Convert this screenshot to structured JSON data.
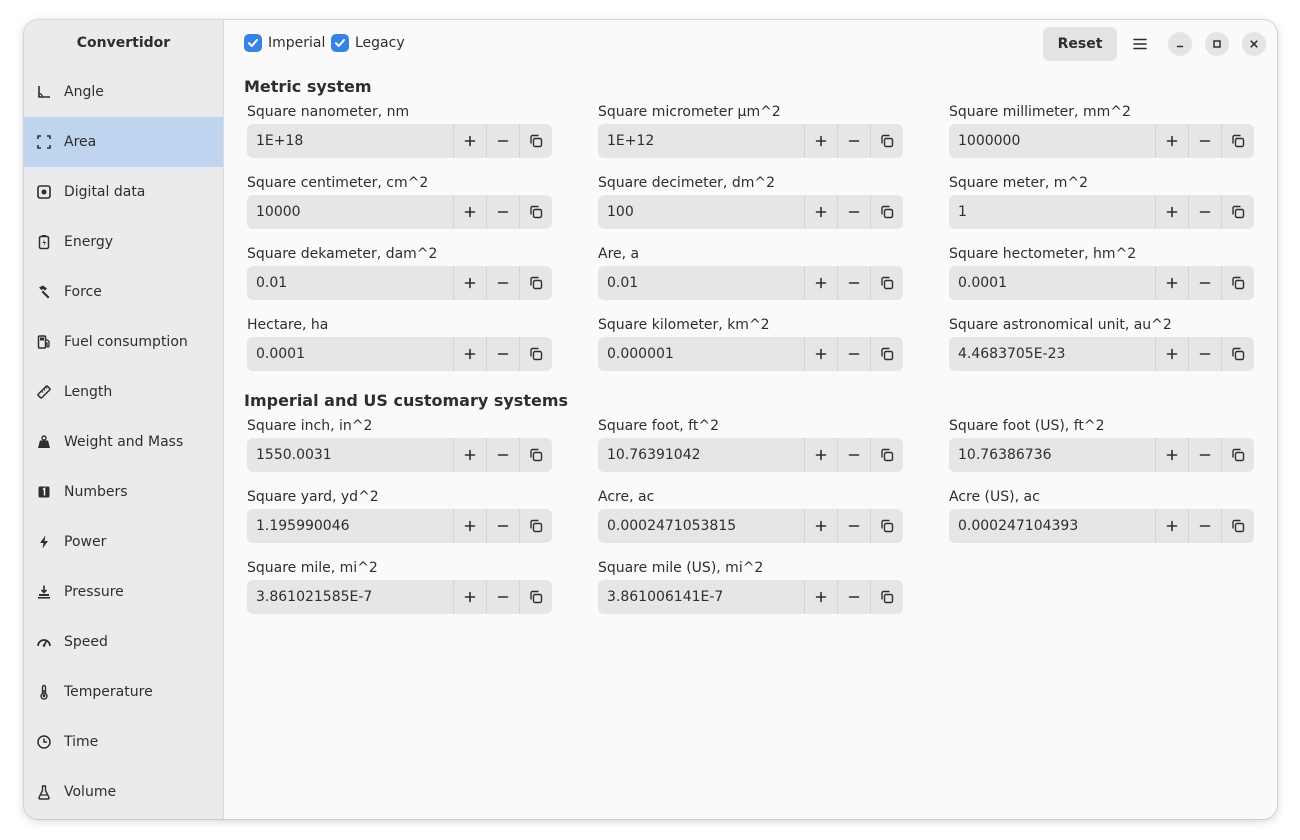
{
  "app": {
    "title": "Convertidor"
  },
  "sidebar": {
    "items": [
      {
        "label": "Angle",
        "icon": "angle-icon",
        "active": false
      },
      {
        "label": "Area",
        "icon": "area-icon",
        "active": true
      },
      {
        "label": "Digital data",
        "icon": "disk-icon",
        "active": false
      },
      {
        "label": "Energy",
        "icon": "battery-icon",
        "active": false
      },
      {
        "label": "Force",
        "icon": "hammer-icon",
        "active": false
      },
      {
        "label": "Fuel consumption",
        "icon": "fuel-pump-icon",
        "active": false
      },
      {
        "label": "Length",
        "icon": "ruler-icon",
        "active": false
      },
      {
        "label": "Weight and Mass",
        "icon": "weight-icon",
        "active": false
      },
      {
        "label": "Numbers",
        "icon": "numbers-icon",
        "active": false
      },
      {
        "label": "Power",
        "icon": "lightning-icon",
        "active": false
      },
      {
        "label": "Pressure",
        "icon": "pressure-icon",
        "active": false
      },
      {
        "label": "Speed",
        "icon": "speedometer-icon",
        "active": false
      },
      {
        "label": "Temperature",
        "icon": "thermometer-icon",
        "active": false
      },
      {
        "label": "Time",
        "icon": "clock-icon",
        "active": false
      },
      {
        "label": "Volume",
        "icon": "flask-icon",
        "active": false
      }
    ]
  },
  "header": {
    "imperial_label": "Imperial",
    "imperial_checked": true,
    "legacy_label": "Legacy",
    "legacy_checked": true,
    "reset_label": "Reset"
  },
  "sections": [
    {
      "title": "Metric system",
      "units": [
        {
          "label": "Square nanometer, nm",
          "value": "1E+18"
        },
        {
          "label": "Square micrometer µm^2",
          "value": "1E+12"
        },
        {
          "label": "Square millimeter, mm^2",
          "value": "1000000"
        },
        {
          "label": "Square centimeter, cm^2",
          "value": "10000"
        },
        {
          "label": "Square decimeter, dm^2",
          "value": "100"
        },
        {
          "label": "Square meter, m^2",
          "value": "1"
        },
        {
          "label": "Square dekameter, dam^2",
          "value": "0.01"
        },
        {
          "label": "Are, a",
          "value": "0.01"
        },
        {
          "label": "Square hectometer, hm^2",
          "value": "0.0001"
        },
        {
          "label": "Hectare, ha",
          "value": "0.0001"
        },
        {
          "label": "Square kilometer, km^2",
          "value": "0.000001"
        },
        {
          "label": "Square astronomical unit, au^2",
          "value": "4.4683705E-23"
        }
      ]
    },
    {
      "title": "Imperial and US customary systems",
      "units": [
        {
          "label": "Square inch, in^2",
          "value": "1550.0031"
        },
        {
          "label": "Square foot, ft^2",
          "value": "10.76391042"
        },
        {
          "label": "Square foot (US), ft^2",
          "value": "10.76386736"
        },
        {
          "label": "Square yard, yd^2",
          "value": "1.195990046"
        },
        {
          "label": "Acre, ac",
          "value": "0.0002471053815"
        },
        {
          "label": "Acre (US), ac",
          "value": "0.000247104393"
        },
        {
          "label": "Square mile, mi^2",
          "value": "3.861021585E-7"
        },
        {
          "label": "Square mile (US), mi^2",
          "value": "3.861006141E-7"
        }
      ]
    }
  ],
  "colors": {
    "accent": "#3584e4",
    "sidebar_active": "#bfd4ee"
  }
}
